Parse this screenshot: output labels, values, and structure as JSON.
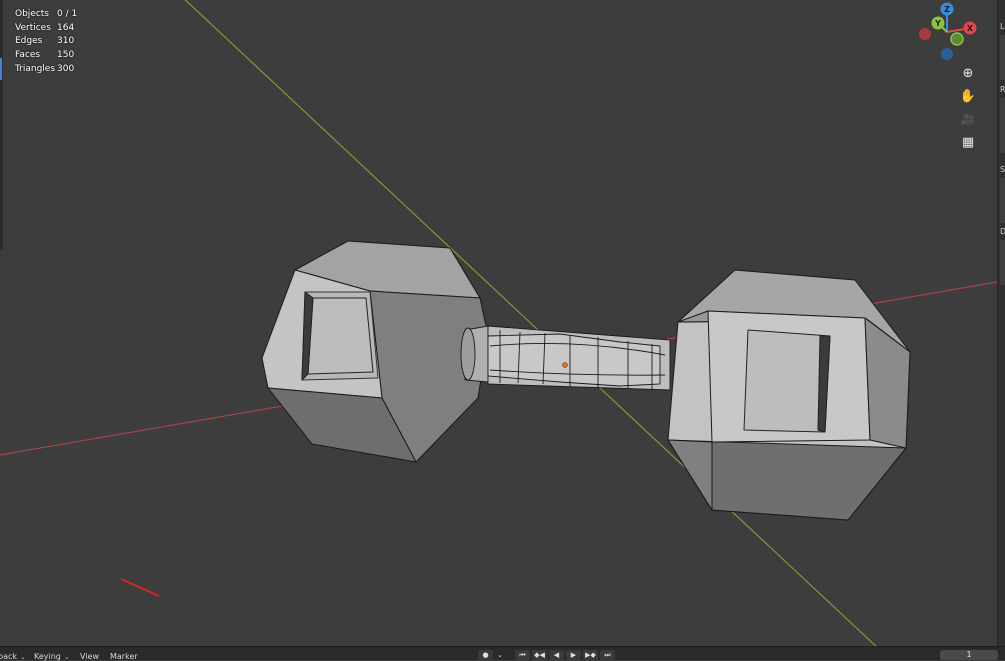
{
  "stats": [
    {
      "label": "Objects",
      "value": "0 / 1"
    },
    {
      "label": "Vertices",
      "value": "164"
    },
    {
      "label": "Edges",
      "value": "310"
    },
    {
      "label": "Faces",
      "value": "150"
    },
    {
      "label": "Triangles",
      "value": "300"
    }
  ],
  "gizmo": {
    "z_label": "Z",
    "y_label": "Y",
    "x_label": "X",
    "colors": {
      "x": "#e0464e",
      "y": "#8ac247",
      "z": "#3a8bd8",
      "neg_x": "#a83a40",
      "neg_y": "#5d8a33",
      "neg_z": "#2a5f9a"
    }
  },
  "nav_buttons": [
    {
      "name": "zoom-icon",
      "glyph": "⊕"
    },
    {
      "name": "pan-hand-icon",
      "glyph": "✋"
    },
    {
      "name": "camera-view-icon",
      "glyph": "🎥"
    },
    {
      "name": "ortho-grid-icon",
      "glyph": "▦"
    }
  ],
  "sidebar": {
    "tabs": [
      "Lo",
      "Ro",
      "Sc",
      "Di"
    ]
  },
  "timeline": {
    "menus": [
      {
        "label": "back",
        "has_caret": true
      },
      {
        "label": "Keying",
        "has_caret": true
      },
      {
        "label": "View",
        "has_caret": false
      },
      {
        "label": "Marker",
        "has_caret": false
      }
    ],
    "transport": [
      "●",
      "⏮",
      "◆◀",
      "◀",
      "▶",
      "▶◆",
      "⏭"
    ],
    "current_frame": "1"
  },
  "axis_colors": {
    "x_axis": "#b8454a",
    "y_axis": "#7a9a36"
  }
}
